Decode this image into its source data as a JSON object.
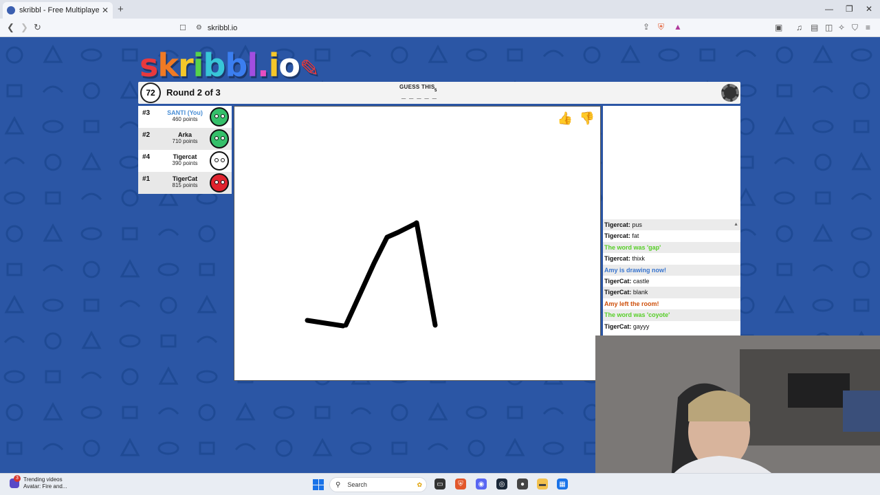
{
  "browser": {
    "tab_title": "skribbl - Free Multiplayer Drawin",
    "url": "skribbl.io"
  },
  "game": {
    "logo_text": "skribbl.io",
    "timer": "72",
    "round_text": "Round 2 of 3",
    "guess_label": "GUESS THIS",
    "word_length": "5",
    "word_blanks": "_ _ _ _ _"
  },
  "players": [
    {
      "rank": "#3",
      "name": "SANTI (You)",
      "points": "460 points",
      "is_you": true,
      "avatar_color": "#35c06a"
    },
    {
      "rank": "#2",
      "name": "Arka",
      "points": "710 points",
      "is_you": false,
      "avatar_color": "#35c06a"
    },
    {
      "rank": "#4",
      "name": "Tigercat",
      "points": "390 points",
      "is_you": false,
      "avatar_color": "#ffffff"
    },
    {
      "rank": "#1",
      "name": "TigerCat",
      "points": "815 points",
      "is_you": false,
      "avatar_color": "#e0232e"
    }
  ],
  "chat": [
    {
      "user": "Tigercat:",
      "text": "pus",
      "color": "#111111"
    },
    {
      "user": "Tigercat:",
      "text": "fat",
      "color": "#111111"
    },
    {
      "user": "",
      "text": "The word was 'gap'",
      "color": "#56ce27"
    },
    {
      "user": "Tigercat:",
      "text": "thixk",
      "color": "#111111"
    },
    {
      "user": "",
      "text": "Amy is drawing now!",
      "color": "#3975ce"
    },
    {
      "user": "TigerCat:",
      "text": "castle",
      "color": "#111111"
    },
    {
      "user": "TigerCat:",
      "text": "blank",
      "color": "#111111"
    },
    {
      "user": "",
      "text": "Amy left the room!",
      "color": "#ce4f0a"
    },
    {
      "user": "",
      "text": "The word was 'coyote'",
      "color": "#56ce27"
    },
    {
      "user": "TigerCat:",
      "text": "gayyy",
      "color": "#111111"
    }
  ],
  "taskbar": {
    "trending_title": "Trending videos",
    "trending_sub": "Avatar: Fire and...",
    "badge": "3",
    "search_label": "Search"
  },
  "colors": {
    "page_bg": "#2b56a5",
    "you_color": "#4a8fd6"
  }
}
